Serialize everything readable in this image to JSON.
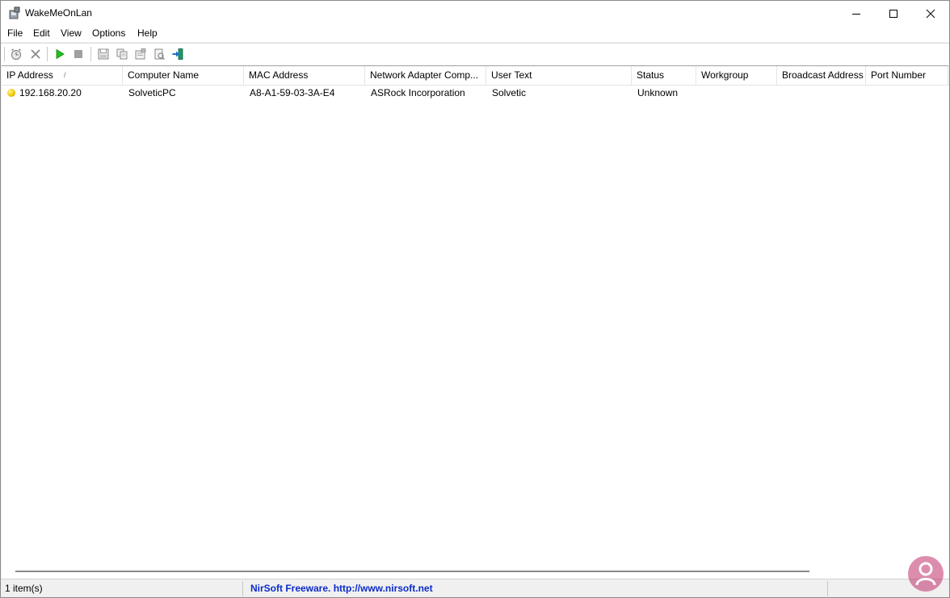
{
  "window": {
    "title": "WakeMeOnLan",
    "accent": "#ffffff"
  },
  "menu": [
    "File",
    "Edit",
    "View",
    "Options",
    "Help"
  ],
  "toolbar": {
    "icons": [
      "alarm-clock-icon",
      "delete-icon",
      "play-icon",
      "stop-icon",
      "save-icon",
      "copy-icon",
      "properties-icon",
      "html-report-icon",
      "exit-icon"
    ]
  },
  "table": {
    "columns": [
      "IP Address",
      "Computer Name",
      "MAC Address",
      "Network Adapter Comp...",
      "User Text",
      "Status",
      "Workgroup",
      "Broadcast Address",
      "Port Number"
    ],
    "sort_indicator": "/",
    "rows": [
      [
        "192.168.20.20",
        "SolveticPC",
        "A8-A1-59-03-3A-E4",
        "ASRock Incorporation",
        "Solvetic",
        "Unknown",
        "",
        "",
        ""
      ]
    ]
  },
  "statusbar": {
    "items_count": "1 item(s)",
    "credit": "NirSoft Freeware.  http://www.nirsoft.net"
  },
  "colors": {
    "link": "#0a2bc8",
    "status_online": "#f0c800",
    "watermark": "#c0306a"
  }
}
